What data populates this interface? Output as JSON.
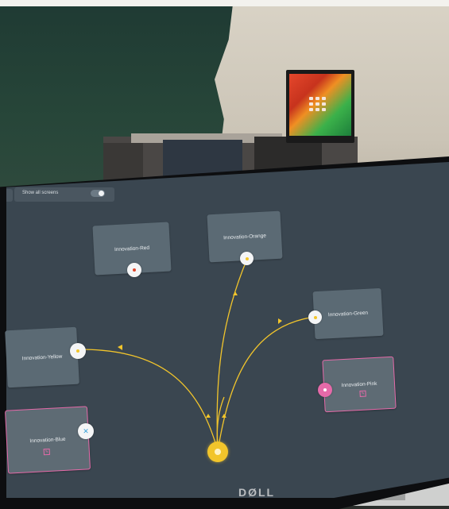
{
  "header": {
    "label": "Show all screens"
  },
  "nodes": {
    "red": "Innovation-Red",
    "orange": "Innovation-Orange",
    "green": "Innovation-Green",
    "yellow": "Innovation-Yellow",
    "pink": "Innovation-Pink",
    "blue": "Innovation-Blue"
  },
  "monitor": {
    "brand": "DØLL"
  },
  "colors": {
    "canvas": "#3a4650",
    "card": "#5b6a74",
    "link": "#f2c52b",
    "selected": "#e56aa9",
    "red_port": "#e0452a"
  }
}
